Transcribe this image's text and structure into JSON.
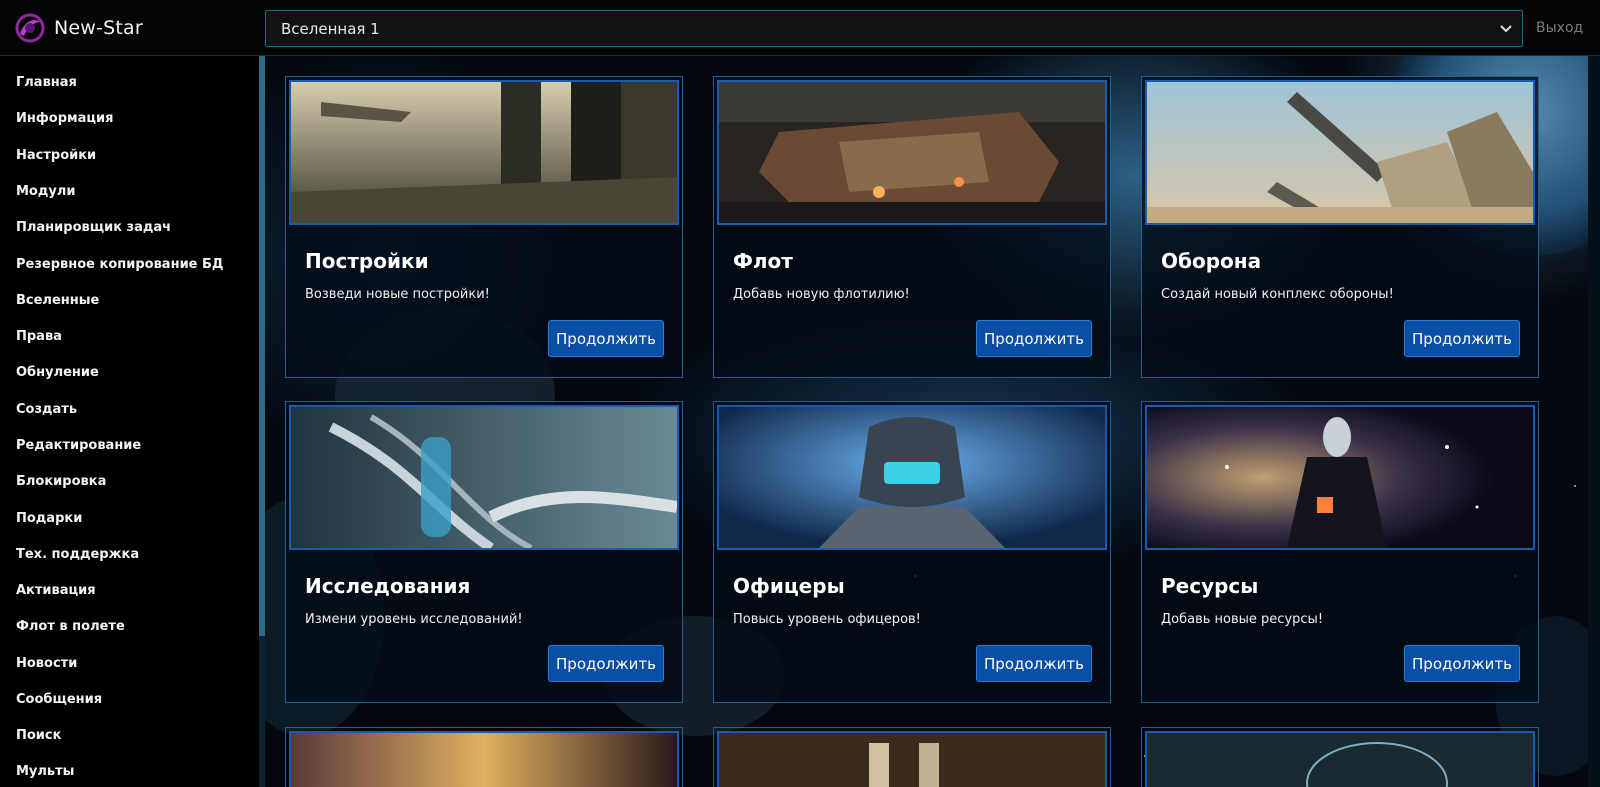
{
  "app": {
    "name": "New-Star"
  },
  "header": {
    "universe_selected": "Вселенная 1",
    "logout_label": "Выход"
  },
  "sidebar": {
    "items": [
      {
        "label": "Главная"
      },
      {
        "label": "Информация"
      },
      {
        "label": "Настройки"
      },
      {
        "label": "Модули"
      },
      {
        "label": "Планировщик задач"
      },
      {
        "label": "Резервное копирование БД"
      },
      {
        "label": "Вселенные"
      },
      {
        "label": "Права"
      },
      {
        "label": "Обнуление"
      },
      {
        "label": "Создать"
      },
      {
        "label": "Редактирование"
      },
      {
        "label": "Блокировка"
      },
      {
        "label": "Подарки"
      },
      {
        "label": "Тех. поддержка"
      },
      {
        "label": "Активация"
      },
      {
        "label": "Флот в полете"
      },
      {
        "label": "Новости"
      },
      {
        "label": "Сообщения"
      },
      {
        "label": "Поиск"
      },
      {
        "label": "Мульты"
      }
    ]
  },
  "cards": [
    {
      "title": "Постройки",
      "text": "Возведи новые постройки!",
      "button": "Продолжить",
      "image": "city-structures-image"
    },
    {
      "title": "Флот",
      "text": "Добавь новую флотилию!",
      "button": "Продолжить",
      "image": "spaceship-fleet-image"
    },
    {
      "title": "Оборона",
      "text": "Создай новый конплекс обороны!",
      "button": "Продолжить",
      "image": "defense-cannons-image"
    },
    {
      "title": "Исследования",
      "text": "Измени уровень исследований!",
      "button": "Продолжить",
      "image": "dna-research-image"
    },
    {
      "title": "Офицеры",
      "text": "Повысь уровень офицеров!",
      "button": "Продолжить",
      "image": "officer-helmet-image"
    },
    {
      "title": "Ресурсы",
      "text": "Добавь новые ресурсы!",
      "button": "Продолжить",
      "image": "resources-cube-image"
    }
  ],
  "colors": {
    "accent": "#0a4fa6",
    "card_border": "#1a5f9a",
    "background": "#000000"
  }
}
